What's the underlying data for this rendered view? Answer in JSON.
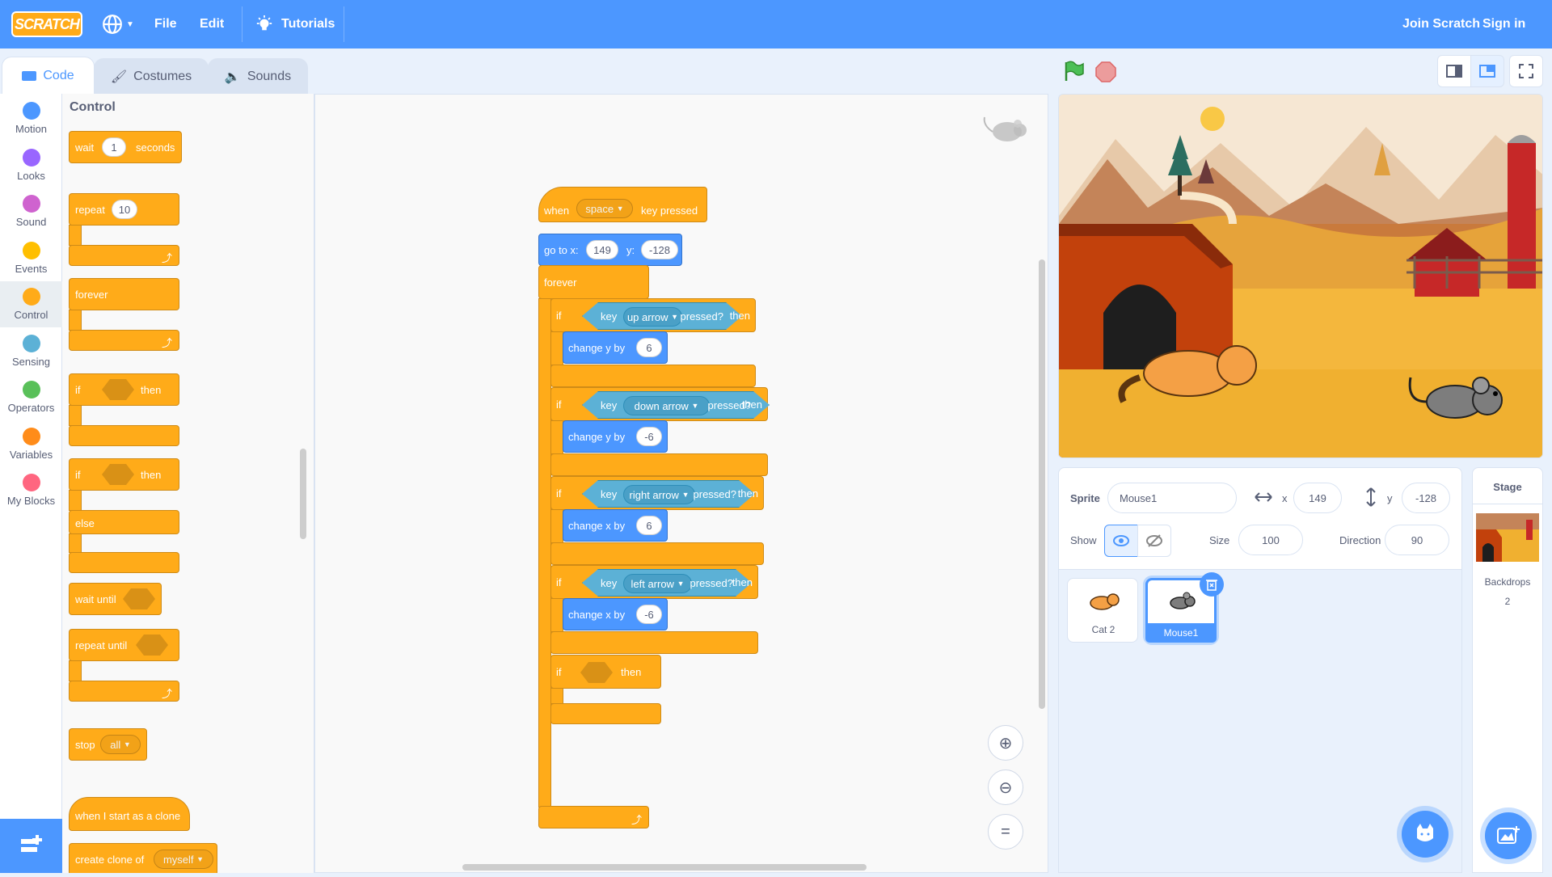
{
  "menubar": {
    "logo": "SCRATCH",
    "file": "File",
    "edit": "Edit",
    "tutorials": "Tutorials",
    "join": "Join Scratch",
    "signin": "Sign in"
  },
  "tabs": {
    "code": "Code",
    "costumes": "Costumes",
    "sounds": "Sounds"
  },
  "categories": [
    "Motion",
    "Looks",
    "Sound",
    "Events",
    "Control",
    "Sensing",
    "Operators",
    "Variables",
    "My Blocks"
  ],
  "category_colors": [
    "#4c97ff",
    "#9966ff",
    "#cf63cf",
    "#ffbf00",
    "#ffab19",
    "#5cb1d6",
    "#59c059",
    "#ff8c1a",
    "#ff6680"
  ],
  "palette": {
    "title": "Control",
    "wait": "wait",
    "wait_value": "1",
    "seconds": "seconds",
    "repeat": "repeat",
    "repeat_value": "10",
    "forever": "forever",
    "if": "if",
    "then": "then",
    "else": "else",
    "wait_until": "wait until",
    "repeat_until": "repeat until",
    "stop": "stop",
    "stop_value": "all",
    "when_clone": "when I start as a clone",
    "create_clone": "create clone of",
    "clone_value": "myself"
  },
  "script": {
    "when": "when",
    "key_value": "space",
    "key_pressed": "key pressed",
    "goto_x": "go to x:",
    "x_value": "149",
    "y_label": "y:",
    "y_value": "-128",
    "forever": "forever",
    "if": "if",
    "then": "then",
    "key": "key",
    "pressed": "pressed?",
    "ifs": [
      {
        "key": "up arrow",
        "action": "change y by",
        "value": "6"
      },
      {
        "key": "down arrow",
        "action": "change y by",
        "value": "-6"
      },
      {
        "key": "right arrow",
        "action": "change x by",
        "value": "6"
      },
      {
        "key": "left arrow",
        "action": "change x by",
        "value": "-6"
      }
    ]
  },
  "sprite_info": {
    "sprite_label": "Sprite",
    "sprite_name": "Mouse1",
    "x_label": "x",
    "x_value": "149",
    "y_label": "y",
    "y_value": "-128",
    "show_label": "Show",
    "size_label": "Size",
    "size_value": "100",
    "direction_label": "Direction",
    "direction_value": "90"
  },
  "sprites": [
    {
      "name": "Cat 2",
      "selected": false
    },
    {
      "name": "Mouse1",
      "selected": true
    }
  ],
  "stage_panel": {
    "title": "Stage",
    "backdrops_label": "Backdrops",
    "backdrops_count": "2"
  },
  "colors": {
    "accent": "#4c97ff",
    "control": "#ffab19",
    "motion": "#4c97ff",
    "sensing": "#5cb1d6"
  }
}
